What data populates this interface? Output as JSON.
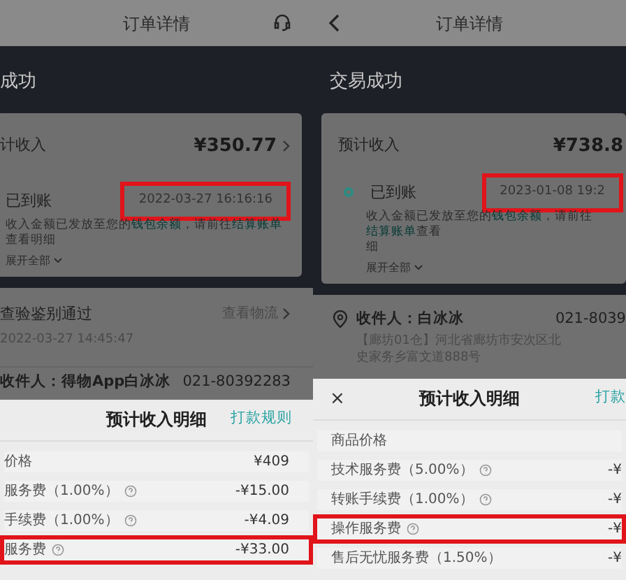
{
  "panels": [
    {
      "header": {
        "back": false,
        "support": true,
        "title": "订单详情"
      },
      "status": "成功",
      "income": {
        "label": "计收入",
        "amount": "¥350.77",
        "arrow": true,
        "dot": false,
        "state": "已到账",
        "time": "2022-03-27 16:16:16",
        "time_highlighted": true,
        "note": [
          {
            "text": "收入金额已发放至您的",
            "link": false
          },
          {
            "text": "钱包余额",
            "link": true
          },
          {
            "text": "，请前往",
            "link": false
          },
          {
            "text": "结算账单",
            "link": true
          },
          {
            "text": "查看明细",
            "link": false
          }
        ],
        "expand": "展开全部"
      },
      "sections": [
        {
          "kind": "logistics",
          "title": "查验鉴别通过",
          "link": "查看物流",
          "time": "2022-03-27 14:45:47"
        },
        {
          "kind": "recipient",
          "pin": false,
          "name": "收件人：得物App白冰冰",
          "phone": "021-80392283"
        }
      ],
      "sheet": {
        "title": "预计收入明细",
        "rule": "打款规则",
        "rows": [
          {
            "label": "价格",
            "info": false,
            "value": "¥409",
            "highlighted": false
          },
          {
            "label": "服务费（1.00%）",
            "info": true,
            "value": "-¥15.00",
            "highlighted": false
          },
          {
            "label": "手续费（1.00%）",
            "info": true,
            "value": "-¥4.09",
            "highlighted": false
          },
          {
            "label": "服务费",
            "info": true,
            "value": "-¥33.00",
            "highlighted": true
          }
        ]
      }
    },
    {
      "header": {
        "back": true,
        "support": false,
        "title": "订单详情"
      },
      "status": "交易成功",
      "income": {
        "label": "预计收入",
        "amount": "¥738.8",
        "arrow": false,
        "dot": true,
        "state": "已到账",
        "time": "2023-01-08 19:2",
        "time_highlighted": true,
        "note": [
          {
            "text": "收入金额已发放至您的",
            "link": false
          },
          {
            "text": "钱包余额",
            "link": true
          },
          {
            "text": "，请前往",
            "link": false
          },
          {
            "text": "结算账单",
            "link": true
          },
          {
            "text": "查看",
            "link": false
          }
        ],
        "note_end": "细",
        "expand": "展开全部"
      },
      "sections": [
        {
          "kind": "recipient",
          "pin": true,
          "name": "收件人：白冰冰",
          "phone": "021-8039",
          "address": "【廊坊01仓】河北省廊坊市安次区北史家务乡富文道888号"
        }
      ],
      "sheet": {
        "close": "×",
        "title": "预计收入明细",
        "rule": "打款",
        "rows": [
          {
            "label": "商品价格",
            "info": false,
            "highlighted": false
          },
          {
            "label": "技术服务费（5.00%）",
            "info": true,
            "value": "-¥",
            "highlighted": false
          },
          {
            "label": "转账手续费（1.00%）",
            "info": true,
            "value": "-¥",
            "highlighted": false
          },
          {
            "label": "操作服务费",
            "info": true,
            "value": "-¥",
            "highlighted": true
          },
          {
            "label": "售后无忧服务费（1.50%）",
            "info": false,
            "value": "-¥",
            "highlighted": false
          }
        ]
      }
    }
  ]
}
